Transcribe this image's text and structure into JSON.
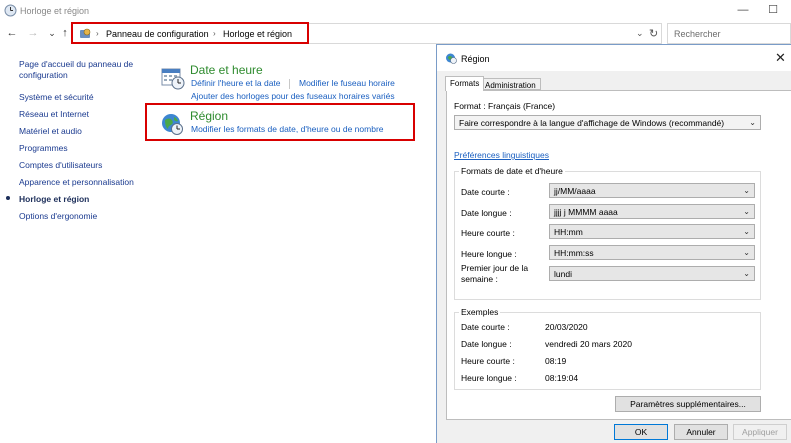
{
  "window": {
    "title": "Horloge et région",
    "minimize": "—",
    "maximize": "☐"
  },
  "nav": {
    "back": "←",
    "forward": "→",
    "recent": "⌄",
    "up": "↑"
  },
  "address": {
    "sep1": "›",
    "crumb1": "Panneau de configuration",
    "sep2": "›",
    "crumb2": "Horloge et région",
    "dropdown": "⌄",
    "refresh": "↻",
    "search_placeholder": "Rechercher"
  },
  "sidebar": {
    "items": [
      {
        "label": "Page d'accueil du panneau de"
      },
      {
        "label": "configuration"
      },
      {
        "label": "Système et sécurité"
      },
      {
        "label": "Réseau et Internet"
      },
      {
        "label": "Matériel et audio"
      },
      {
        "label": "Programmes"
      },
      {
        "label": "Comptes d'utilisateurs"
      },
      {
        "label": "Apparence et personnalisation"
      },
      {
        "label": "Horloge et région"
      },
      {
        "label": "Options d'ergonomie"
      }
    ]
  },
  "categories": {
    "datetime": {
      "title": "Date et heure",
      "link1": "Définir l'heure et la date",
      "link2": "Modifier le fuseau horaire",
      "link3": "Ajouter des horloges pour des fuseaux horaires variés"
    },
    "region": {
      "title": "Région",
      "link1": "Modifier les formats de date, d'heure ou de nombre"
    }
  },
  "dialog": {
    "title": "Région",
    "close": "✕",
    "tabs": [
      "Formats",
      "Administration"
    ],
    "format_label": "Format : Français (France)",
    "format_value": "Faire correspondre à la langue d'affichage de Windows (recommandé)",
    "pref_link": "Préférences linguistiques",
    "formats_group": {
      "title": "Formats de date et d'heure",
      "rows": [
        {
          "label": "Date courte :",
          "value": "jj/MM/aaaa"
        },
        {
          "label": "Date longue :",
          "value": "jjjj j MMMM aaaa"
        },
        {
          "label": "Heure courte :",
          "value": "HH:mm"
        },
        {
          "label": "Heure longue :",
          "value": "HH:mm:ss"
        },
        {
          "label1": "Premier jour de la",
          "label2": "semaine :",
          "value": "lundi"
        }
      ]
    },
    "examples_group": {
      "title": "Exemples",
      "rows": [
        {
          "label": "Date courte :",
          "value": "20/03/2020"
        },
        {
          "label": "Date longue :",
          "value": "vendredi 20 mars 2020"
        },
        {
          "label": "Heure courte :",
          "value": "08:19"
        },
        {
          "label": "Heure longue :",
          "value": "08:19:04"
        }
      ]
    },
    "more_button": "Paramètres supplémentaires...",
    "ok": "OK",
    "cancel": "Annuler",
    "apply": "Appliquer",
    "combo_arrow": "⌄"
  },
  "colors": {
    "highlight": "#d80000",
    "link": "#1a5fc0",
    "category_title": "#2e8b2e"
  }
}
